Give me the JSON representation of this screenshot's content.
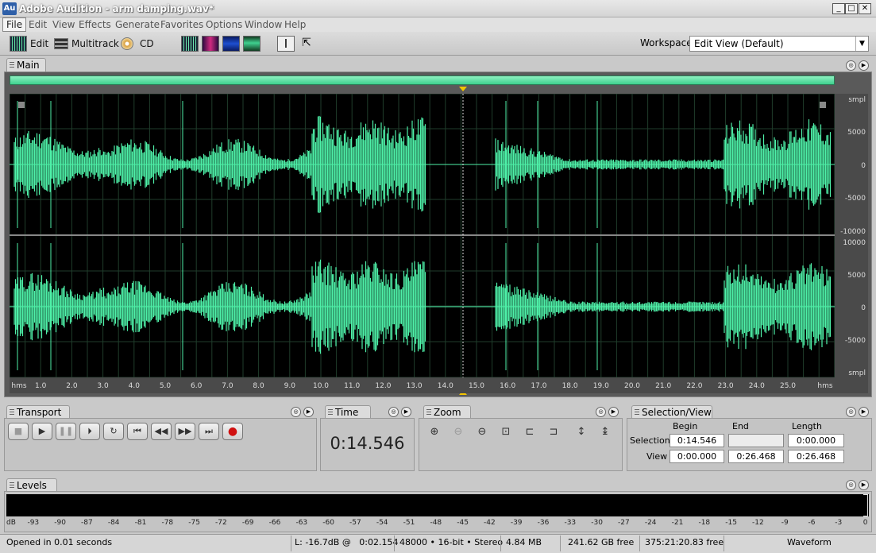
{
  "window": {
    "title": "Adobe Audition - arm damping.wav*",
    "logo": "Au",
    "minimize": "_",
    "maximize": "□",
    "close": "✕"
  },
  "menu": [
    "File",
    "Edit",
    "View",
    "Effects",
    "Generate",
    "Favorites",
    "Options",
    "Window",
    "Help"
  ],
  "toolbar": {
    "edit_label": "Edit",
    "multitrack_label": "Multitrack",
    "cd_label": "CD"
  },
  "workspace": {
    "label": "Workspace:",
    "value": "Edit View (Default)"
  },
  "main_panel": {
    "tab": "Main"
  },
  "waveform": {
    "amp_labels_top": [
      "smpl",
      "5000",
      "0",
      "-5000",
      "-10000"
    ],
    "amp_labels_bottom": [
      "10000",
      "5000",
      "0",
      "-5000",
      "smpl"
    ],
    "time_ticks": [
      "hms",
      "1.0",
      "2.0",
      "3.0",
      "4.0",
      "5.0",
      "6.0",
      "7.0",
      "8.0",
      "9.0",
      "10.0",
      "11.0",
      "12.0",
      "13.0",
      "14.0",
      "15.0",
      "16.0",
      "17.0",
      "18.0",
      "19.0",
      "20.0",
      "21.0",
      "22.0",
      "23.0",
      "24.0",
      "25.0",
      "hms"
    ],
    "wave_color": "#4ef0a8"
  },
  "transport": {
    "tab": "Transport"
  },
  "time": {
    "tab": "Time",
    "value": "0:14.546"
  },
  "zoom": {
    "tab": "Zoom"
  },
  "selection_view": {
    "tab": "Selection/View",
    "col_begin": "Begin",
    "col_end": "End",
    "col_length": "Length",
    "row_selection": "Selection",
    "row_view": "View",
    "selection_begin": "0:14.546",
    "selection_end": "",
    "selection_length": "0:00.000",
    "view_begin": "0:00.000",
    "view_end": "0:26.468",
    "view_length": "0:26.468"
  },
  "levels": {
    "tab": "Levels",
    "scale": [
      "dB",
      "-93",
      "-90",
      "-87",
      "-84",
      "-81",
      "-78",
      "-75",
      "-72",
      "-69",
      "-66",
      "-63",
      "-60",
      "-57",
      "-54",
      "-51",
      "-48",
      "-45",
      "-42",
      "-39",
      "-36",
      "-33",
      "-30",
      "-27",
      "-24",
      "-21",
      "-18",
      "-15",
      "-12",
      "-9",
      "-6",
      "-3",
      "0"
    ]
  },
  "status": {
    "message": "Opened in 0.01 seconds",
    "level": "L: -16.7dB @   0:02.154",
    "format": "48000 • 16-bit • Stereo",
    "size": "4.84 MB",
    "free": "241.62 GB free",
    "free_time": "375:21:20.83 free",
    "mode": "Waveform"
  }
}
